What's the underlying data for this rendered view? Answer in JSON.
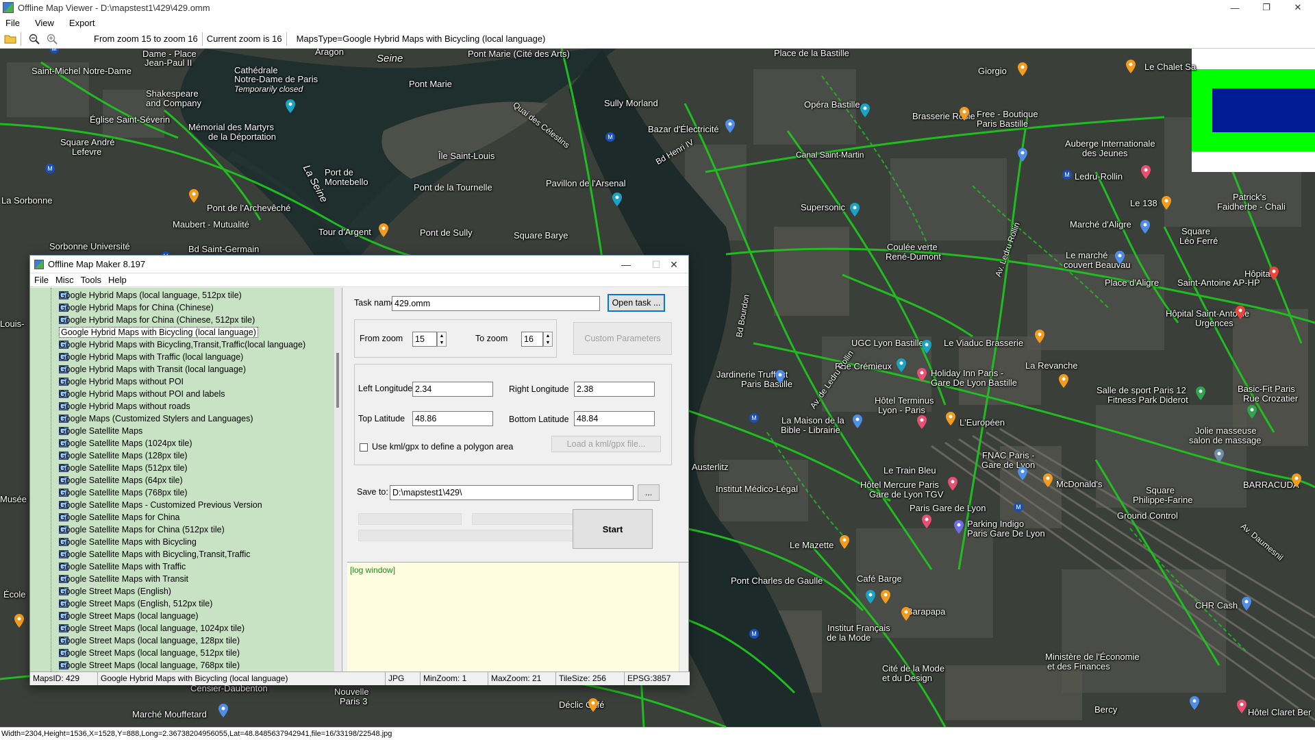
{
  "viewer": {
    "title": "Offline Map Viewer - D:\\mapstest1\\429\\429.omm",
    "menu": [
      "File",
      "View",
      "Export"
    ],
    "toolbar": {
      "zoom_range": "From zoom 15 to zoom 16",
      "current_zoom": "Current zoom is 16",
      "maps_type": "MapsType=Google Hybrid Maps with Bicycling (local language)"
    },
    "status": "Width=2304,Height=1536,X=1528,Y=888,Long=2.36738204956055,Lat=48.8485637942941,file=16/33198/22548.jpg"
  },
  "map": {
    "labels": [
      "Dame - Place",
      "Jean-Paul II",
      "Saint-Michel Notre-Dame",
      "Cathédrale",
      "Notre-Dame de Paris",
      "Temporarily closed",
      "Shakespeare",
      "and Company",
      "Église Saint-Séverin",
      "Mémorial des Martyrs",
      "de la Déportation",
      "Square André",
      "Lefevre",
      "La Sorbonne",
      "Maubert - Mutualité",
      "Pont de l'Archevêché",
      "Sorbonne Université",
      "Bd Saint-Germain",
      "Tour d'Argent",
      "Pont de Sully",
      "Square Barye",
      "Pont de la Tournelle",
      "Île Saint-Louis",
      "Port de",
      "Montebello",
      "Pont Marie",
      "Pont Marie (Cité des Arts)",
      "Seine",
      "La Seine",
      "Aragon",
      "Sully Morland",
      "Bazar d'Électricité",
      "Pavillon de l'Arsenal",
      "Quai des Célestins",
      "Bd Henri IV",
      "Place de la Bastille",
      "Opéra Bastille",
      "Giorgio",
      "Brasserie Rosie",
      "Free - Boutique",
      "Paris Bastille",
      "Le Chalet Sa",
      "Auberge Internationale",
      "des Jeunes",
      "Ledru-Rollin",
      "Le 138",
      "Patrick's",
      "Faidherbe - Chali",
      "Marché d'Aligre",
      "Square",
      "Léo Ferré",
      "Supersonic",
      "Coulée verte",
      "René-Dumont",
      "Le marché",
      "couvert Beauvau",
      "Place d'Aligre",
      "Saint-Antoine AP-HP",
      "Hôpital Saint-Antoine",
      "Urgences",
      "Hôpital",
      "UGC Lyon Bastille",
      "Le Viaduc Brasserie",
      "Rue Crémieux",
      "La Revanche",
      "Holiday Inn Paris -",
      "Gare De Lyon Bastille",
      "Jardinerie Truffaut",
      "Paris Bastille",
      "Hôtel Terminus",
      "Lyon - Paris",
      "L'Européen",
      "Salle de sport Paris 12",
      "Fitness Park Diderot",
      "Basic-Fit Paris",
      "Rue Crozatier",
      "Jolie masseuse",
      "salon de massage",
      "La Maison de la",
      "Bible - Librairie",
      "Austerlitz",
      "Institut Médico-Légal",
      "Le Train Bleu",
      "FNAC Paris -",
      "Gare de Lyon",
      "McDonald's",
      "BARRACUDA",
      "Square",
      "Philippe-Farine",
      "Hôtel Mercure Paris",
      "Gare de Lyon TGV",
      "Paris Gare de Lyon",
      "Parking Indigo",
      "Paris Gare De Lyon",
      "Ground Control",
      "Le Mazette",
      "Pont Charles de Gaulle",
      "Café Barge",
      "Barapapa",
      "Institut Français",
      "de la Mode",
      "CHR Cash",
      "Ministère de l'Économie",
      "et des Finances",
      "Cité de la Mode",
      "et du Design",
      "Déclic Café",
      "Marché Mouffetard",
      "Nouvelle",
      "Paris 3",
      "Censier-Daubenton",
      "Bercy",
      "Hôtel Claret Ber",
      "École",
      "Musée",
      "Louis-",
      "Bd Bourdon",
      "Canal Saint-Martin",
      "Av. Ledru Rollin",
      "Av. Daumesnil",
      "Av. de Ledru Rollin"
    ]
  },
  "dialog": {
    "title": "Offline Map Maker 8.197",
    "menu": [
      "File",
      "Misc",
      "Tools",
      "Help"
    ],
    "tree_items": [
      "Google Hybrid Maps (local language, 512px tile)",
      "Google Hybrid Maps for China (Chinese)",
      "Google Hybrid Maps for China (Chinese, 512px tile)",
      "Google Hybrid Maps with Bicycling (local language)",
      "Google Hybrid Maps with Bicycling,Transit,Traffic(local language)",
      "Google Hybrid Maps with Traffic (local language)",
      "Google Hybrid Maps with Transit (local language)",
      "Google Hybrid Maps without POI",
      "Google Hybrid Maps without POI and labels",
      "Google Hybrid Maps without roads",
      "Google Maps (Customized Stylers and Languages)",
      "Google Satellite Maps",
      "Google Satellite Maps (1024px tile)",
      "Google Satellite Maps (128px tile)",
      "Google Satellite Maps (512px tile)",
      "Google Satellite Maps (64px tile)",
      "Google Satellite Maps (768px tile)",
      "Google Satellite Maps - Customized Previous Version",
      "Google Satellite Maps for China",
      "Google Satellite Maps for China (512px tile)",
      "Google Satellite Maps with Bicycling",
      "Google Satellite Maps with Bicycling,Transit,Traffic",
      "Google Satellite Maps with Traffic",
      "Google Satellite Maps with Transit",
      "Google Street Maps (English)",
      "Google Street Maps (English, 512px tile)",
      "Google Street Maps (local language)",
      "Google Street Maps (local language, 1024px tile)",
      "Google Street Maps (local language, 128px tile)",
      "Google Street Maps (local language, 512px tile)",
      "Google Street Maps (local language, 768px tile)"
    ],
    "selected_index": 3,
    "task_name_label": "Task name",
    "task_name_value": "429.omm",
    "open_task_label": "Open task ...",
    "from_zoom_label": "From zoom",
    "from_zoom_value": "15",
    "to_zoom_label": "To zoom",
    "to_zoom_value": "16",
    "custom_params_label": "Custom Parameters",
    "left_lon_label": "Left Longitude",
    "left_lon_value": "2.34",
    "right_lon_label": "Right Longitude",
    "right_lon_value": "2.38",
    "top_lat_label": "Top Latitude",
    "top_lat_value": "48.86",
    "bottom_lat_label": "Bottom Latitude",
    "bottom_lat_value": "48.84",
    "kml_label": "Use kml/gpx to define a polygon area",
    "load_kml_label": "Load a kml/gpx file...",
    "save_to_label": "Save to:",
    "save_to_value": "D:\\mapstest1\\429\\",
    "browse_label": "...",
    "start_label": "Start",
    "log_text": "[log window]",
    "status": {
      "maps_id": "MapsID: 429",
      "maps_name": "Google Hybrid Maps with Bicycling (local language)",
      "format": "JPG",
      "min_zoom": "MinZoom: 1",
      "max_zoom": "MaxZoom: 21",
      "tile_size": "TileSize: 256",
      "epsg": "EPSG:3857"
    }
  },
  "colors": {
    "tree_bg": "#c8e3c4",
    "log_bg": "#fffde0",
    "bike_route": "#1fc41f",
    "overlay_green": "#00ff00",
    "overlay_blue": "#001b94"
  }
}
